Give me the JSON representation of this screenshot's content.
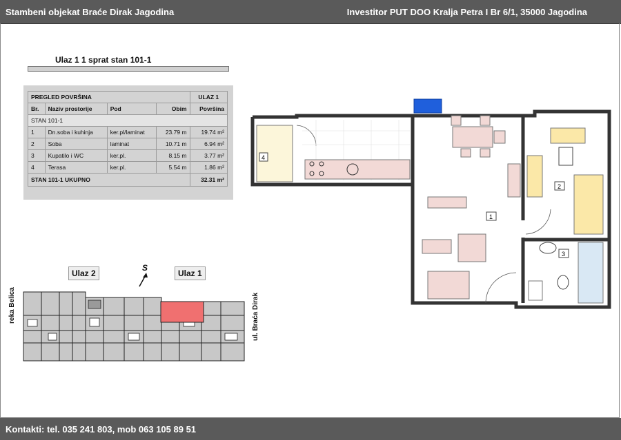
{
  "header": {
    "left": "Stambeni objekat Braće Dirak  Jagodina",
    "right": "Investitor PUT DOO Kralja Petra I Br 6/1, 35000 Jagodina"
  },
  "unit_title": "Ulaz 1 1 sprat stan 101-1",
  "table": {
    "title": "PREGLED POVRŠINA",
    "entrance": "ULAZ 1",
    "headers": [
      "Br.",
      "Naziv prostorije",
      "Pod",
      "Obim",
      "Površina"
    ],
    "section": "STAN 101-1",
    "rows": [
      {
        "no": "1",
        "name": "Dn.soba i kuhinja",
        "floor": "ker.pl/laminat",
        "perimeter": "23.79 m",
        "area": "19.74 m²"
      },
      {
        "no": "2",
        "name": "Soba",
        "floor": "laminat",
        "perimeter": "10.71 m",
        "area": "6.94 m²"
      },
      {
        "no": "3",
        "name": "Kupatilo i WC",
        "floor": "ker.pl.",
        "perimeter": "8.15 m",
        "area": "3.77 m²"
      },
      {
        "no": "4",
        "name": "Terasa",
        "floor": "ker.pl.",
        "perimeter": "5.54 m",
        "area": "1.86 m²"
      }
    ],
    "total_label": "STAN 101-1   UKUPNO",
    "total_area": "32.31 m²"
  },
  "site_plan": {
    "entrance_2": "Ulaz 2",
    "entrance_1": "Ulaz 1",
    "north": "S",
    "street_left": "reka Belica",
    "street_right": "ul. Braća Dirak",
    "highlight_color": "#f07070"
  },
  "floor_plan": {
    "room_labels": [
      "1",
      "2",
      "3",
      "4"
    ],
    "window_color": "#1f5fdc",
    "furniture_color": "#f2d9d6",
    "bed_color": "#fbe8a8"
  },
  "footer": "Kontakti: tel. 035 241 803, mob 063 105 89 51"
}
